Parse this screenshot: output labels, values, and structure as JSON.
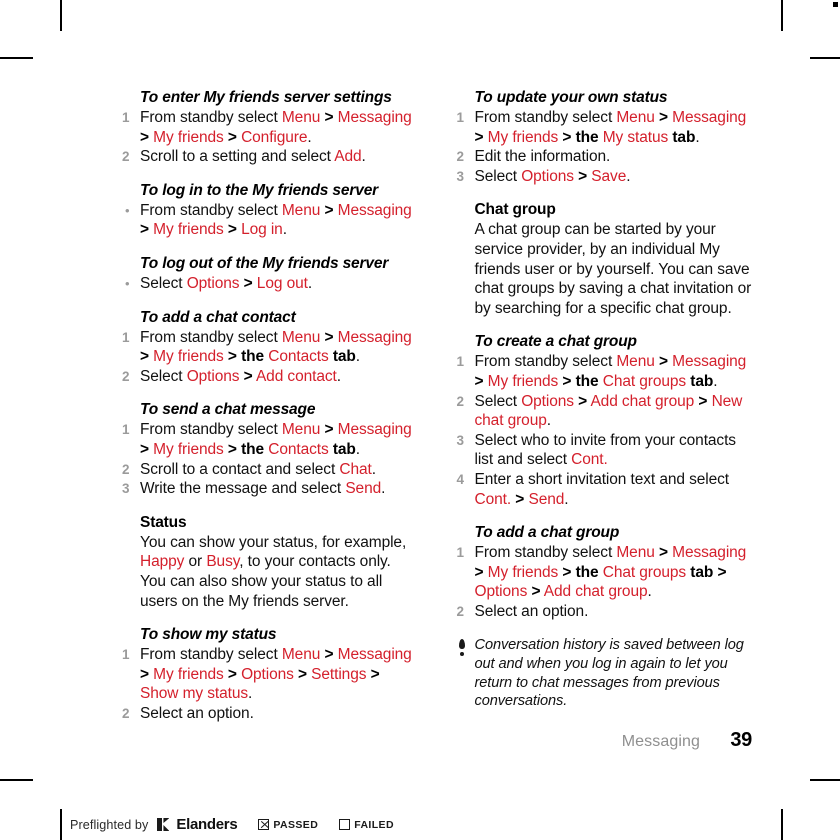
{
  "page": {
    "chapter": "Messaging",
    "number": "39"
  },
  "left_column": {
    "sections": [
      {
        "heading": "To enter My friends server settings",
        "heading_style": "italic",
        "list_type": "ordered",
        "items": [
          "From standby select <span class=\"r\">Menu</span> <span class=\"gt\">&gt;</span> <span class=\"r\">Messaging</span> <span class=\"gt\">&gt;</span> <span class=\"r\">My friends</span> <span class=\"gt\">&gt;</span> <span class=\"r\">Configure</span>.",
          "Scroll to a setting and select <span class=\"r\">Add</span>."
        ]
      },
      {
        "heading": "To log in to the My friends server",
        "heading_style": "italic",
        "list_type": "bullet",
        "items": [
          "From standby select <span class=\"r\">Menu</span> <span class=\"gt\">&gt;</span> <span class=\"r\">Messaging</span> <span class=\"gt\">&gt;</span> <span class=\"r\">My friends</span> <span class=\"gt\">&gt;</span> <span class=\"r\">Log in</span>."
        ]
      },
      {
        "heading": "To log out of the My friends server",
        "heading_style": "italic",
        "list_type": "bullet",
        "items": [
          "Select <span class=\"r\">Options</span> <span class=\"gt\">&gt;</span> <span class=\"r\">Log out</span>."
        ]
      },
      {
        "heading": "To add a chat contact",
        "heading_style": "italic",
        "list_type": "ordered",
        "items": [
          "From standby select <span class=\"r\">Menu</span> <span class=\"gt\">&gt;</span> <span class=\"r\">Messaging</span> <span class=\"gt\">&gt;</span> <span class=\"r\">My friends</span> <span class=\"gt\">&gt;</span> <span class=\"b\">the</span> <span class=\"r\">Contacts</span> <span class=\"b\">tab</span>.",
          "Select <span class=\"r\">Options</span> <span class=\"gt\">&gt;</span> <span class=\"r\">Add contact</span>."
        ]
      },
      {
        "heading": "To send a chat message",
        "heading_style": "italic",
        "list_type": "ordered",
        "items": [
          "From standby select <span class=\"r\">Menu</span> <span class=\"gt\">&gt;</span> <span class=\"r\">Messaging</span> <span class=\"gt\">&gt;</span> <span class=\"r\">My friends</span> <span class=\"gt\">&gt;</span> <span class=\"b\">the</span> <span class=\"r\">Contacts</span> <span class=\"b\">tab</span>.",
          "Scroll to a contact and select <span class=\"r\">Chat</span>.",
          "Write the message and select <span class=\"r\">Send</span>."
        ]
      },
      {
        "heading": "Status",
        "heading_style": "upright",
        "list_type": "paragraph",
        "items": [
          "You can show your status, for example, <span class=\"r\">Happy</span> or <span class=\"r\">Busy</span>, to your contacts only. You can also show your status to all users on the My friends server."
        ]
      },
      {
        "heading": "To show my status",
        "heading_style": "italic",
        "list_type": "ordered",
        "items": [
          "From standby select <span class=\"r\">Menu</span> <span class=\"gt\">&gt;</span> <span class=\"r\">Messaging</span> <span class=\"gt\">&gt;</span> <span class=\"r\">My friends</span> <span class=\"gt\">&gt;</span> <span class=\"r\">Options</span> <span class=\"gt\">&gt;</span> <span class=\"r\">Settings</span> <span class=\"gt\">&gt;</span> <span class=\"r\">Show my status</span>.",
          "Select an option."
        ]
      }
    ]
  },
  "right_column": {
    "sections": [
      {
        "heading": "To update your own status",
        "heading_style": "italic",
        "list_type": "ordered",
        "items": [
          "From standby select <span class=\"r\">Menu</span> <span class=\"gt\">&gt;</span> <span class=\"r\">Messaging</span> <span class=\"gt\">&gt;</span> <span class=\"r\">My friends</span> <span class=\"gt\">&gt;</span> <span class=\"b\">the</span> <span class=\"r\">My status</span> <span class=\"b\">tab</span>.",
          "Edit the information.",
          "Select <span class=\"r\">Options</span> <span class=\"gt\">&gt;</span> <span class=\"r\">Save</span>."
        ]
      },
      {
        "heading": "Chat group",
        "heading_style": "upright",
        "list_type": "paragraph",
        "items": [
          "A chat group can be started by your service provider, by an individual My friends user or by yourself. You can save chat groups by saving a chat invitation or by searching for a specific chat group."
        ]
      },
      {
        "heading": "To create a chat group",
        "heading_style": "italic",
        "list_type": "ordered",
        "items": [
          "From standby select <span class=\"r\">Menu</span> <span class=\"gt\">&gt;</span> <span class=\"r\">Messaging</span> <span class=\"gt\">&gt;</span> <span class=\"r\">My friends</span> <span class=\"gt\">&gt;</span> <span class=\"b\">the</span> <span class=\"r\">Chat groups</span> <span class=\"b\">tab</span>.",
          "Select <span class=\"r\">Options</span> <span class=\"gt\">&gt;</span> <span class=\"r\">Add chat group</span> <span class=\"gt\">&gt;</span> <span class=\"r\">New chat group</span>.",
          "Select who to invite from your contacts list and select <span class=\"r\">Cont.</span>",
          "Enter a short invitation text and select <span class=\"r\">Cont.</span> <span class=\"gt\">&gt;</span> <span class=\"r\">Send</span>."
        ]
      },
      {
        "heading": "To add a chat group",
        "heading_style": "italic",
        "list_type": "ordered",
        "items": [
          "From standby select <span class=\"r\">Menu</span> <span class=\"gt\">&gt;</span> <span class=\"r\">Messaging</span> <span class=\"gt\">&gt;</span> <span class=\"r\">My friends</span> <span class=\"gt\">&gt;</span> <span class=\"b\">the</span> <span class=\"r\">Chat groups</span> <span class=\"b\">tab</span> <span class=\"gt\">&gt;</span> <span class=\"r\">Options</span> <span class=\"gt\">&gt;</span> <span class=\"r\">Add chat group</span>.",
          "Select an option."
        ]
      }
    ],
    "tip": {
      "icon": "tip-bulb-icon",
      "text": "Conversation history is saved between log out and when you log in again to let you return to chat messages from previous conversations."
    }
  },
  "preflight": {
    "prefix": "Preflighted by",
    "logo": "elanders-logo-icon",
    "brand": "Elanders",
    "passed_label": "PASSED",
    "failed_label": "FAILED",
    "passed_checked": true,
    "failed_checked": false
  },
  "colors": {
    "accent_red": "#d4202c",
    "step_number_gray": "#9b9b9b",
    "chapter_gray": "#8f8f8f",
    "text_black": "#111111"
  }
}
